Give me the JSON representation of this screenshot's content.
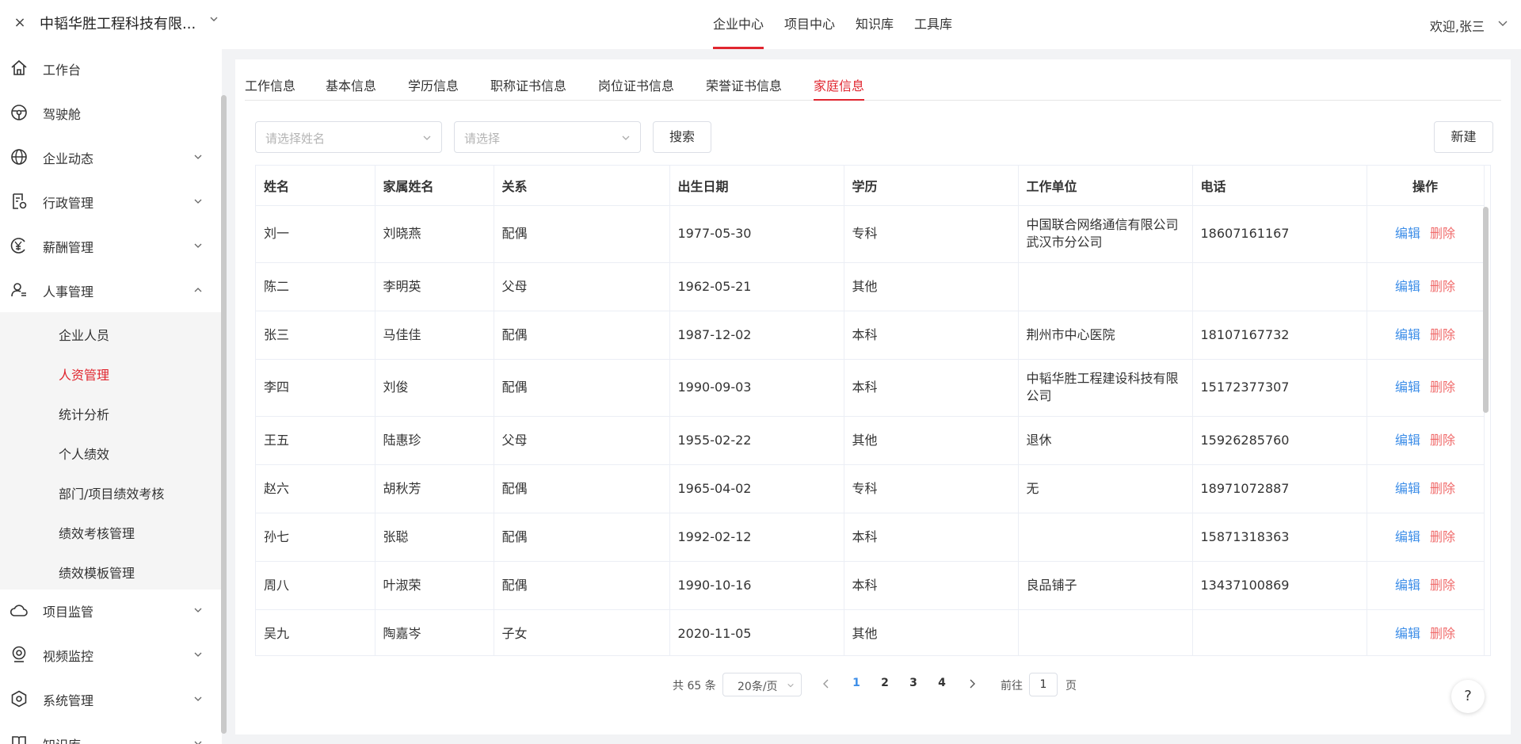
{
  "header": {
    "close": "×",
    "company": "中韬华胜工程科技有限...",
    "nav": [
      "企业中心",
      "项目中心",
      "知识库",
      "工具库"
    ],
    "nav_active": 0,
    "welcome": "欢迎,张三"
  },
  "sidebar": {
    "items": [
      {
        "label": "工作台",
        "icon": "home-icon"
      },
      {
        "label": "驾驶舱",
        "icon": "steering-wheel-icon"
      },
      {
        "label": "企业动态",
        "icon": "globe-icon"
      },
      {
        "label": "行政管理",
        "icon": "document-gear-icon"
      },
      {
        "label": "薪酬管理",
        "icon": "yen-icon"
      },
      {
        "label": "人事管理",
        "icon": "user-list-icon"
      }
    ],
    "sub_items": [
      "企业人员",
      "人资管理",
      "统计分析",
      "个人绩效",
      "部门/项目绩效考核",
      "绩效考核管理",
      "绩效模板管理"
    ],
    "sub_active": 1,
    "bottom_items": [
      {
        "label": "项目监管",
        "icon": "cloud-icon"
      },
      {
        "label": "视频监控",
        "icon": "camera-icon"
      },
      {
        "label": "系统管理",
        "icon": "settings-icon"
      },
      {
        "label": "知识库",
        "icon": "book-icon"
      }
    ]
  },
  "tabs": [
    "工作信息",
    "基本信息",
    "学历信息",
    "职称证书信息",
    "岗位证书信息",
    "荣誉证书信息",
    "家庭信息"
  ],
  "tab_active": 6,
  "filters": {
    "name_placeholder": "请选择姓名",
    "type_placeholder": "请选择",
    "search": "搜索",
    "new": "新建"
  },
  "table": {
    "headers": [
      "姓名",
      "家属姓名",
      "关系",
      "出生日期",
      "学历",
      "工作单位",
      "电话",
      "操作"
    ],
    "rows": [
      [
        "刘一",
        "刘晓燕",
        "配偶",
        "1977-05-30",
        "专科",
        "中国联合网络通信有限公司武汉市分公司",
        "18607161167"
      ],
      [
        "陈二",
        "李明英",
        "父母",
        "1962-05-21",
        "其他",
        "",
        ""
      ],
      [
        "张三",
        "马佳佳",
        "配偶",
        "1987-12-02",
        "本科",
        "荆州市中心医院",
        "18107167732"
      ],
      [
        "李四",
        "刘俊",
        "配偶",
        "1990-09-03",
        "本科",
        "中韬华胜工程建设科技有限公司",
        "15172377307"
      ],
      [
        "王五",
        "陆惠珍",
        "父母",
        "1955-02-22",
        "其他",
        "退休",
        "15926285760"
      ],
      [
        "赵六",
        "胡秋芳",
        "配偶",
        "1965-04-02",
        "专科",
        "无",
        "18971072887"
      ],
      [
        "孙七",
        "张聪",
        "配偶",
        "1992-02-12",
        "本科",
        "",
        "15871318363"
      ],
      [
        "周八",
        "叶淑荣",
        "配偶",
        "1990-10-16",
        "本科",
        "良品铺子",
        "13437100869"
      ],
      [
        "吴九",
        "陶嘉岑",
        "子女",
        "2020-11-05",
        "其他",
        "",
        ""
      ]
    ],
    "edit": "编辑",
    "delete": "删除"
  },
  "pagination": {
    "total": "共 65 条",
    "page_size": "20条/页",
    "pages": [
      "1",
      "2",
      "3",
      "4"
    ],
    "current": "1",
    "goto": "前往",
    "goto_value": "1",
    "page_unit": "页"
  },
  "help": "?",
  "colors": {
    "accent": "#e0262f",
    "link": "#3d8ee8",
    "danger": "#f06c6c"
  }
}
